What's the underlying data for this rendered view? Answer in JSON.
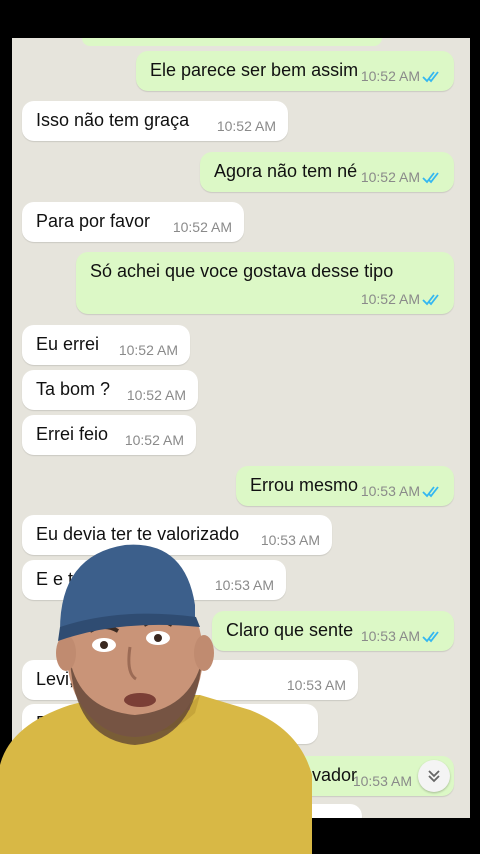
{
  "messages": [
    {
      "dir": "out",
      "text": "Ele parece ser bem assim",
      "time": "10:52 AM"
    },
    {
      "dir": "in",
      "text": "Isso não tem graça",
      "time": "10:52 AM"
    },
    {
      "dir": "out",
      "text": "Agora não tem né",
      "time": "10:52 AM"
    },
    {
      "dir": "in",
      "text": "Para por favor",
      "time": "10:52 AM"
    },
    {
      "dir": "out",
      "text": "Só achei que voce gostava desse tipo",
      "time": "10:52 AM"
    },
    {
      "dir": "in",
      "text": "Eu errei",
      "time": "10:52 AM"
    },
    {
      "dir": "in",
      "text": "Ta bom ?",
      "time": "10:52 AM"
    },
    {
      "dir": "in",
      "text": "Errei feio",
      "time": "10:52 AM"
    },
    {
      "dir": "out",
      "text": "Errou mesmo",
      "time": "10:53 AM"
    },
    {
      "dir": "in",
      "text": "Eu devia ter te valorizado",
      "time": "10:53 AM"
    },
    {
      "dir": "in",
      "text": "E e         ta",
      "time": "10:53 AM"
    },
    {
      "dir": "out",
      "text": "Claro que sente",
      "time": "10:53 AM"
    },
    {
      "dir": "in",
      "text": "Levi,             por favor",
      "time": "10:53 AM"
    },
    {
      "dir": "in",
      "text": "Ele",
      "time": ""
    },
    {
      "dir": "out",
      "text": "vador",
      "time": "10:53 AM"
    }
  ],
  "icons": {
    "read_ticks": "double-check-icon",
    "scroll_down": "chevron-double-down-icon"
  },
  "colors": {
    "incoming": "#ffffff",
    "outgoing": "#dcf8c6",
    "background": "#e6e4dc",
    "tick": "#34b7f1"
  }
}
